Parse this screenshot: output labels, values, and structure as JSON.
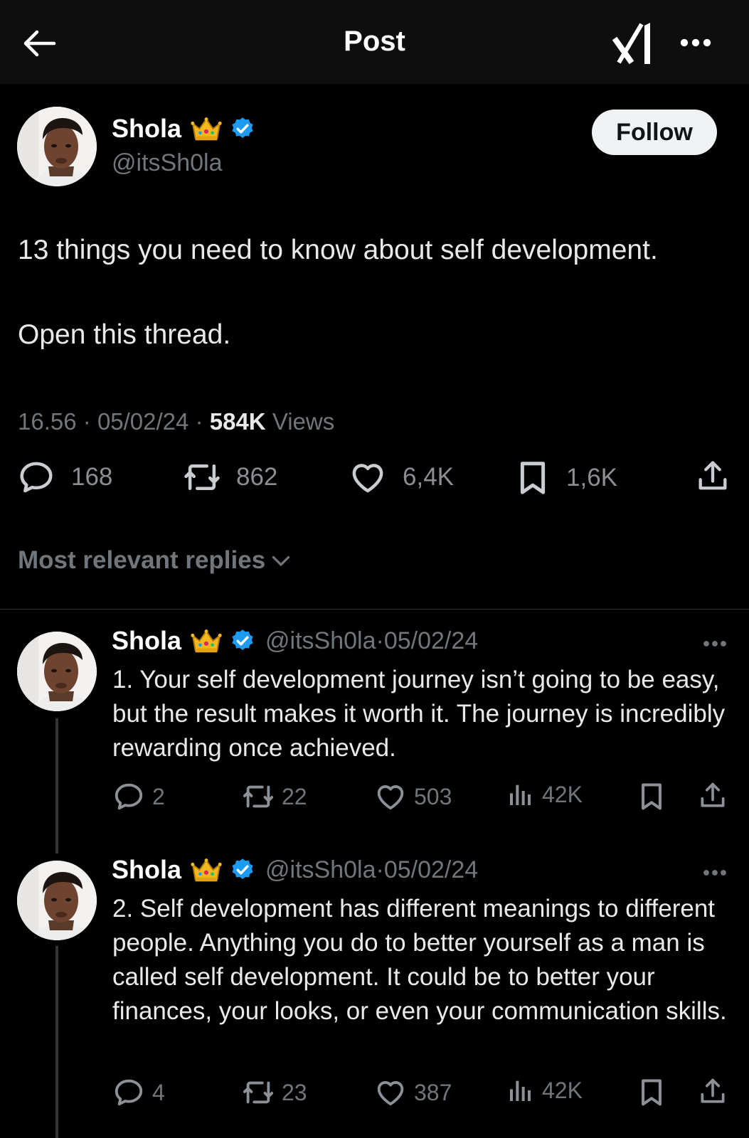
{
  "header": {
    "title": "Post"
  },
  "post": {
    "author": {
      "name": "Shola",
      "handle": "@itsSh0la",
      "emoji": "👑"
    },
    "follow_label": "Follow",
    "text_line1": "13 things you need to know about self development.",
    "text_line2": "Open this thread.",
    "time": "16.56",
    "date": "05/02/24",
    "views_count": "584K",
    "views_label": "Views",
    "stats": {
      "replies": "168",
      "reposts": "862",
      "likes": "6,4K",
      "bookmarks": "1,6K"
    }
  },
  "sort_label": "Most relevant replies",
  "replies": [
    {
      "name": "Shola",
      "handle": "@itsSh0la",
      "date": "05/02/24",
      "text": "1. Your self development journey isn’t going to be easy, but the result makes it worth it. The journey is incredibly rewarding once achieved.",
      "stats": {
        "replies": "2",
        "reposts": "22",
        "likes": "503",
        "views": "42K"
      }
    },
    {
      "name": "Shola",
      "handle": "@itsSh0la",
      "date": "05/02/24",
      "text": "2. Self development has different meanings to different people. Anything you do to better yourself as a man is called self development. It could be to better your finances, your looks, or even your communication skills.",
      "stats": {
        "replies": "4",
        "reposts": "23",
        "likes": "387",
        "views": "42K"
      }
    }
  ],
  "colors": {
    "background": "#000000",
    "header": "#0e0e0e",
    "verified": "#1d9bf0",
    "muted": "#71767b",
    "text": "#e7e9ea"
  },
  "icons": [
    "back-arrow-icon",
    "grok-icon",
    "more-icon",
    "verified-badge-icon",
    "crown-icon",
    "reply-icon",
    "repost-icon",
    "like-icon",
    "bookmark-icon",
    "share-icon",
    "views-icon",
    "chevron-down-icon"
  ]
}
